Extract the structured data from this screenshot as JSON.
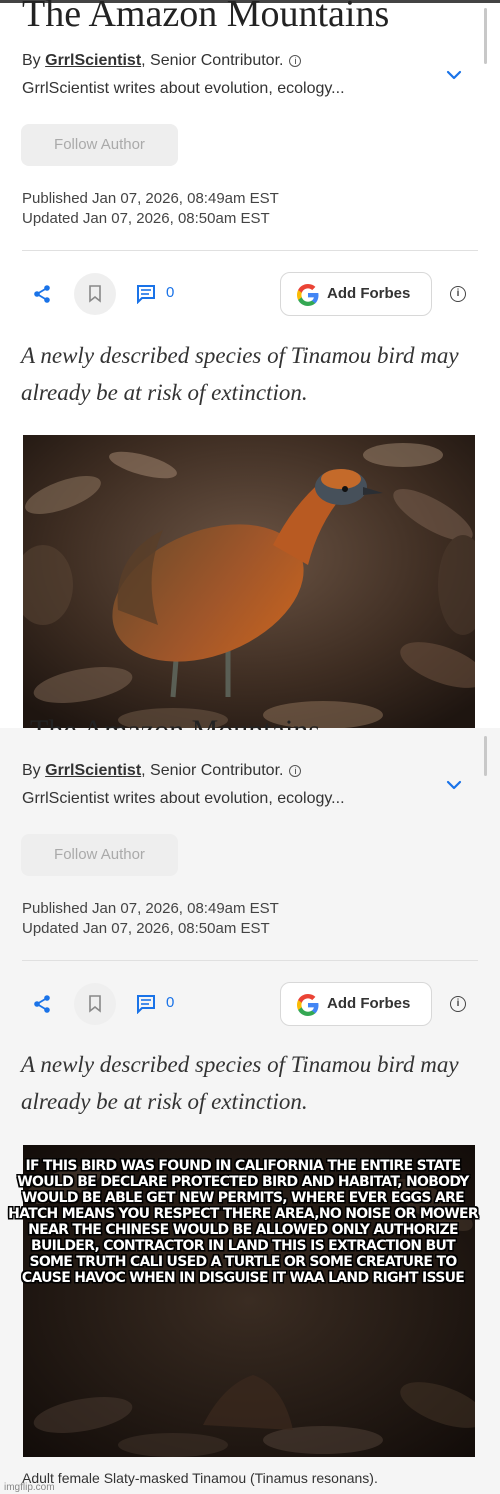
{
  "article": {
    "title": "The Amazon Mountains",
    "by_prefix": "By ",
    "author": "GrrlScientist",
    "role": ", Senior Contributor.",
    "description": "GrrlScientist writes about evolution, ecology...",
    "follow_label": "Follow Author",
    "published": "Published Jan 07, 2026, 08:49am EST",
    "updated": "Updated Jan 07, 2026, 08:50am EST",
    "comment_count": "0",
    "add_forbes_label": "Add Forbes",
    "dek": "A newly described species of Tinamou bird may already be at risk of extinction.",
    "caption": "Adult female Slaty-masked Tinamou (Tinamus resonans)."
  },
  "meme": {
    "text": "IF THIS BIRD WAS FOUND IN CALIFORNIA THE ENTIRE STATE WOULD BE DECLARE PROTECTED BIRD AND HABITAT, NOBODY WOULD BE ABLE GET NEW PERMITS, WHERE EVER EGGS ARE HATCH MEANS YOU RESPECT THERE AREA,NO NOISE OR MOWER NEAR THE CHINESE WOULD BE ALLOWED ONLY AUTHORIZE BUILDER, CONTRACTOR IN LAND THIS IS EXTRACTION BUT SOME TRUTH CALI USED A TURTLE OR SOME CREATURE TO CAUSE HAVOC WHEN IN DISGUISE IT WAA LAND RIGHT ISSUE",
    "watermark": "imgflip.com"
  },
  "icons": {
    "share": "share-icon",
    "bookmark": "bookmark-icon",
    "comment": "comment-icon",
    "google": "google-logo-icon",
    "info": "info-icon",
    "chevron": "chevron-down-icon"
  },
  "colors": {
    "link_blue": "#1a73e8",
    "button_gray": "#eeeeee",
    "meme_text": "#ffffff"
  }
}
